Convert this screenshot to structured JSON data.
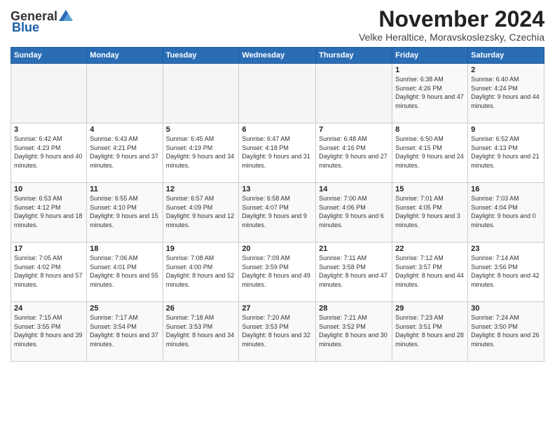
{
  "logo": {
    "general": "General",
    "blue": "Blue"
  },
  "header": {
    "title": "November 2024",
    "location": "Velke Heraltice, Moravskoslezsky, Czechia"
  },
  "weekdays": [
    "Sunday",
    "Monday",
    "Tuesday",
    "Wednesday",
    "Thursday",
    "Friday",
    "Saturday"
  ],
  "weeks": [
    [
      {
        "day": "",
        "info": ""
      },
      {
        "day": "",
        "info": ""
      },
      {
        "day": "",
        "info": ""
      },
      {
        "day": "",
        "info": ""
      },
      {
        "day": "",
        "info": ""
      },
      {
        "day": "1",
        "info": "Sunrise: 6:38 AM\nSunset: 4:26 PM\nDaylight: 9 hours and 47 minutes."
      },
      {
        "day": "2",
        "info": "Sunrise: 6:40 AM\nSunset: 4:24 PM\nDaylight: 9 hours and 44 minutes."
      }
    ],
    [
      {
        "day": "3",
        "info": "Sunrise: 6:42 AM\nSunset: 4:23 PM\nDaylight: 9 hours and 40 minutes."
      },
      {
        "day": "4",
        "info": "Sunrise: 6:43 AM\nSunset: 4:21 PM\nDaylight: 9 hours and 37 minutes."
      },
      {
        "day": "5",
        "info": "Sunrise: 6:45 AM\nSunset: 4:19 PM\nDaylight: 9 hours and 34 minutes."
      },
      {
        "day": "6",
        "info": "Sunrise: 6:47 AM\nSunset: 4:18 PM\nDaylight: 9 hours and 31 minutes."
      },
      {
        "day": "7",
        "info": "Sunrise: 6:48 AM\nSunset: 4:16 PM\nDaylight: 9 hours and 27 minutes."
      },
      {
        "day": "8",
        "info": "Sunrise: 6:50 AM\nSunset: 4:15 PM\nDaylight: 9 hours and 24 minutes."
      },
      {
        "day": "9",
        "info": "Sunrise: 6:52 AM\nSunset: 4:13 PM\nDaylight: 9 hours and 21 minutes."
      }
    ],
    [
      {
        "day": "10",
        "info": "Sunrise: 6:53 AM\nSunset: 4:12 PM\nDaylight: 9 hours and 18 minutes."
      },
      {
        "day": "11",
        "info": "Sunrise: 6:55 AM\nSunset: 4:10 PM\nDaylight: 9 hours and 15 minutes."
      },
      {
        "day": "12",
        "info": "Sunrise: 6:57 AM\nSunset: 4:09 PM\nDaylight: 9 hours and 12 minutes."
      },
      {
        "day": "13",
        "info": "Sunrise: 6:58 AM\nSunset: 4:07 PM\nDaylight: 9 hours and 9 minutes."
      },
      {
        "day": "14",
        "info": "Sunrise: 7:00 AM\nSunset: 4:06 PM\nDaylight: 9 hours and 6 minutes."
      },
      {
        "day": "15",
        "info": "Sunrise: 7:01 AM\nSunset: 4:05 PM\nDaylight: 9 hours and 3 minutes."
      },
      {
        "day": "16",
        "info": "Sunrise: 7:03 AM\nSunset: 4:04 PM\nDaylight: 9 hours and 0 minutes."
      }
    ],
    [
      {
        "day": "17",
        "info": "Sunrise: 7:05 AM\nSunset: 4:02 PM\nDaylight: 8 hours and 57 minutes."
      },
      {
        "day": "18",
        "info": "Sunrise: 7:06 AM\nSunset: 4:01 PM\nDaylight: 8 hours and 55 minutes."
      },
      {
        "day": "19",
        "info": "Sunrise: 7:08 AM\nSunset: 4:00 PM\nDaylight: 8 hours and 52 minutes."
      },
      {
        "day": "20",
        "info": "Sunrise: 7:09 AM\nSunset: 3:59 PM\nDaylight: 8 hours and 49 minutes."
      },
      {
        "day": "21",
        "info": "Sunrise: 7:11 AM\nSunset: 3:58 PM\nDaylight: 8 hours and 47 minutes."
      },
      {
        "day": "22",
        "info": "Sunrise: 7:12 AM\nSunset: 3:57 PM\nDaylight: 8 hours and 44 minutes."
      },
      {
        "day": "23",
        "info": "Sunrise: 7:14 AM\nSunset: 3:56 PM\nDaylight: 8 hours and 42 minutes."
      }
    ],
    [
      {
        "day": "24",
        "info": "Sunrise: 7:15 AM\nSunset: 3:55 PM\nDaylight: 8 hours and 39 minutes."
      },
      {
        "day": "25",
        "info": "Sunrise: 7:17 AM\nSunset: 3:54 PM\nDaylight: 8 hours and 37 minutes."
      },
      {
        "day": "26",
        "info": "Sunrise: 7:18 AM\nSunset: 3:53 PM\nDaylight: 8 hours and 34 minutes."
      },
      {
        "day": "27",
        "info": "Sunrise: 7:20 AM\nSunset: 3:53 PM\nDaylight: 8 hours and 32 minutes."
      },
      {
        "day": "28",
        "info": "Sunrise: 7:21 AM\nSunset: 3:52 PM\nDaylight: 8 hours and 30 minutes."
      },
      {
        "day": "29",
        "info": "Sunrise: 7:23 AM\nSunset: 3:51 PM\nDaylight: 8 hours and 28 minutes."
      },
      {
        "day": "30",
        "info": "Sunrise: 7:24 AM\nSunset: 3:50 PM\nDaylight: 8 hours and 26 minutes."
      }
    ]
  ]
}
